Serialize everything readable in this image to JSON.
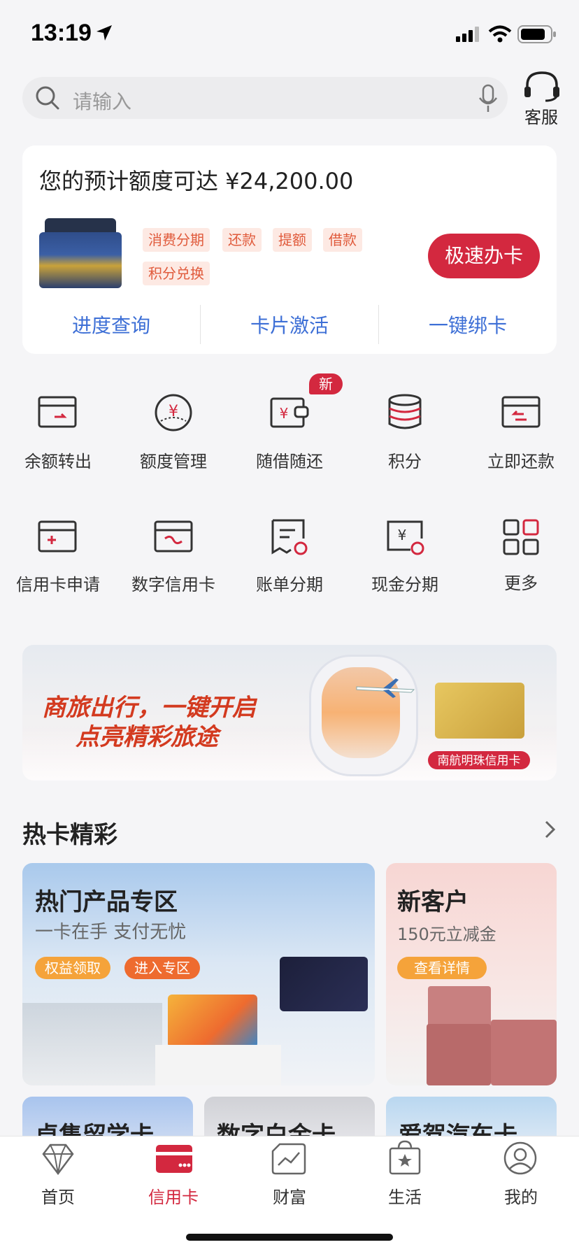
{
  "status": {
    "time": "13:19"
  },
  "search": {
    "placeholder": "请输入",
    "service_label": "客服"
  },
  "card_panel": {
    "quota_text": "您的预计额度可达 ¥24,200.00",
    "tags": [
      "消费分期",
      "还款",
      "提额",
      "借款",
      "积分兑换"
    ],
    "apply_label": "极速办卡",
    "links": [
      "进度查询",
      "卡片激活",
      "一键绑卡"
    ]
  },
  "grid": {
    "row1": [
      "余额转出",
      "额度管理",
      "随借随还",
      "积分",
      "立即还款"
    ],
    "row2": [
      "信用卡申请",
      "数字信用卡",
      "账单分期",
      "现金分期",
      "更多"
    ],
    "new_badge": "新"
  },
  "banner": {
    "line1": "商旅出行，一键开启",
    "line2": "点亮精彩旅途",
    "tag": "南航明珠信用卡"
  },
  "hot": {
    "title": "热卡精彩",
    "card1": {
      "title": "热门产品专区",
      "subtitle": "一卡在手 支付无忧",
      "btn1": "权益领取",
      "btn2": "进入专区"
    },
    "card2": {
      "title": "新客户",
      "subtitle": "150元立减金",
      "btn": "查看详情"
    },
    "mini": [
      "卓隽留学卡",
      "数字白金卡",
      "爱驾汽车卡"
    ]
  },
  "tabs": [
    "首页",
    "信用卡",
    "财富",
    "生活",
    "我的"
  ],
  "colors": {
    "accent": "#d3283f",
    "link": "#3d6fd6",
    "tag_text": "#e05a3b"
  }
}
